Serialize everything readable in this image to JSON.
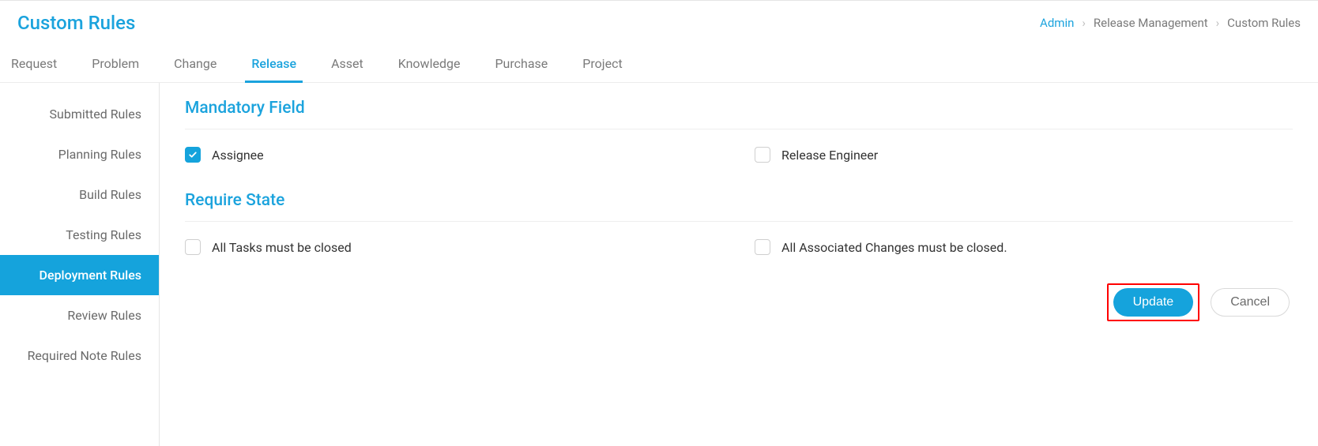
{
  "header": {
    "title": "Custom Rules",
    "breadcrumb": {
      "link": "Admin",
      "mid": "Release Management",
      "current": "Custom Rules"
    }
  },
  "tabs": [
    {
      "label": "Request",
      "key": "request",
      "active": false
    },
    {
      "label": "Problem",
      "key": "problem",
      "active": false
    },
    {
      "label": "Change",
      "key": "change",
      "active": false
    },
    {
      "label": "Release",
      "key": "release",
      "active": true
    },
    {
      "label": "Asset",
      "key": "asset",
      "active": false
    },
    {
      "label": "Knowledge",
      "key": "knowledge",
      "active": false
    },
    {
      "label": "Purchase",
      "key": "purchase",
      "active": false
    },
    {
      "label": "Project",
      "key": "project",
      "active": false
    }
  ],
  "sidebar": [
    {
      "label": "Submitted Rules",
      "key": "submitted",
      "active": false
    },
    {
      "label": "Planning Rules",
      "key": "planning",
      "active": false
    },
    {
      "label": "Build Rules",
      "key": "build",
      "active": false
    },
    {
      "label": "Testing Rules",
      "key": "testing",
      "active": false
    },
    {
      "label": "Deployment Rules",
      "key": "deployment",
      "active": true
    },
    {
      "label": "Review Rules",
      "key": "review",
      "active": false
    },
    {
      "label": "Required Note Rules",
      "key": "required-note",
      "active": false
    }
  ],
  "sections": {
    "mandatory": {
      "title": "Mandatory Field",
      "fields": [
        {
          "label": "Assignee",
          "checked": true
        },
        {
          "label": "Release Engineer",
          "checked": false
        }
      ]
    },
    "requireState": {
      "title": "Require State",
      "fields": [
        {
          "label": "All Tasks must be closed",
          "checked": false
        },
        {
          "label": "All Associated Changes must be closed.",
          "checked": false
        }
      ]
    }
  },
  "actions": {
    "primary": "Update",
    "secondary": "Cancel"
  }
}
